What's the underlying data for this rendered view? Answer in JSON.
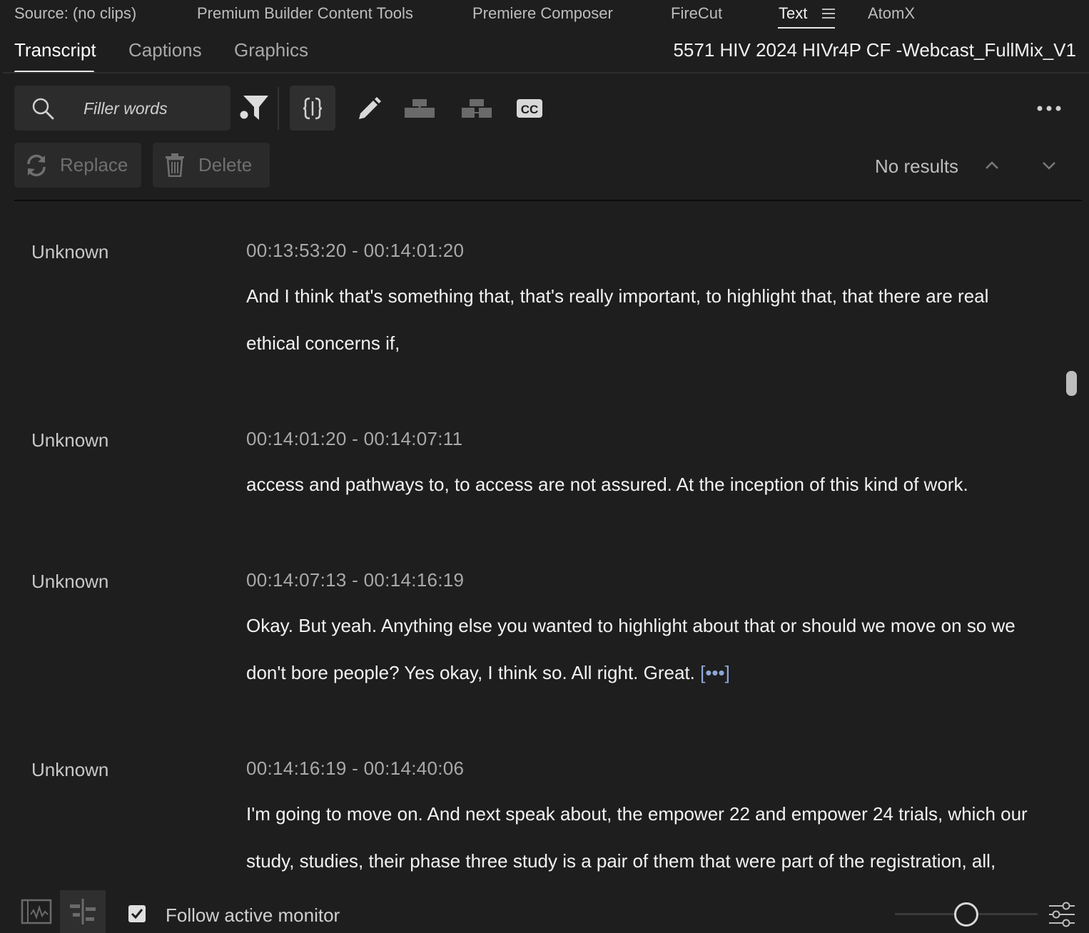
{
  "panel_tabs": [
    {
      "label": "Source: (no clips)"
    },
    {
      "label": "Premium Builder Content Tools"
    },
    {
      "label": "Premiere Composer"
    },
    {
      "label": "FireCut"
    },
    {
      "label": "Text",
      "active": true
    },
    {
      "label": "AtomX"
    }
  ],
  "sub_tabs": [
    {
      "label": "Transcript",
      "active": true
    },
    {
      "label": "Captions"
    },
    {
      "label": "Graphics"
    }
  ],
  "sequence_name": "5571 HIV 2024 HIVr4P CF -Webcast_FullMix_V1",
  "search": {
    "placeholder": "Filler words",
    "value": ""
  },
  "toolbar": {
    "icons": [
      "search-icon",
      "filter-icon",
      "edit-mode-icon",
      "pencil-icon",
      "merge-segment-icon",
      "split-segment-icon",
      "cc-icon",
      "more-icon"
    ],
    "cc_label": "CC"
  },
  "actions": {
    "replace_label": "Replace",
    "delete_label": "Delete"
  },
  "search_results": {
    "label": "No results"
  },
  "transcript": [
    {
      "speaker": "Unknown",
      "timecode": "00:13:53:20 - 00:14:01:20",
      "lines": [
        "And I think that's something that, that's really important, to highlight that, that there are real",
        "ethical concerns if,"
      ]
    },
    {
      "speaker": "Unknown",
      "timecode": "00:14:01:20 - 00:14:07:11",
      "lines": [
        "access and pathways to, to access are not assured. At the inception of this kind of work."
      ]
    },
    {
      "speaker": "Unknown",
      "timecode": "00:14:07:13 - 00:14:16:19",
      "lines": [
        "Okay. But yeah. Anything else you wanted to highlight about that or should we move on so we",
        "don't bore people? Yes okay, I think so. All right. Great."
      ],
      "ellipsis": "[•••]"
    },
    {
      "speaker": "Unknown",
      "timecode": "00:14:16:19 - 00:14:40:06",
      "lines": [
        "I'm going to move on. And next speak about, the empower 22 and empower 24 trials, which our",
        "study, studies, their phase three study is a pair of them that were part of the registration, all,"
      ]
    }
  ],
  "bottom_bar": {
    "follow_label": "Follow active monitor",
    "follow_checked": true,
    "icons": [
      "clip-view-icon",
      "sequence-view-icon",
      "settings-sliders-icon"
    ]
  },
  "colors": {
    "background": "#1e1e1e",
    "panel": "#2c2c2c",
    "text": "#f2f2f2",
    "muted": "#a9a9a9",
    "link": "#8da7d8"
  }
}
